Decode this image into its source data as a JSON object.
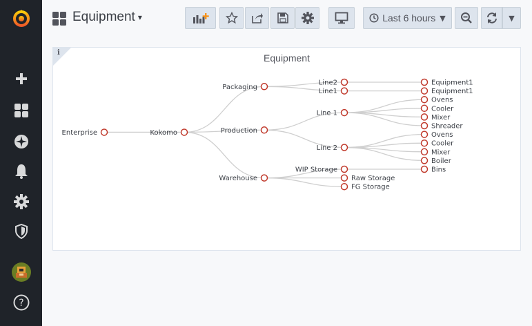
{
  "sidebar": {
    "items": [
      {
        "name": "grafana-logo-icon"
      },
      {
        "name": "plus-icon"
      },
      {
        "name": "dashboards-icon"
      },
      {
        "name": "explore-compass-icon"
      },
      {
        "name": "alerting-bell-icon"
      },
      {
        "name": "configuration-gear-icon"
      },
      {
        "name": "server-admin-shield-icon"
      },
      {
        "name": "user-avatar"
      },
      {
        "name": "help-icon"
      }
    ]
  },
  "header": {
    "title": "Equipment",
    "time_range": "Last 6 hours"
  },
  "colors": {
    "sidebar_bg": "#1f2329",
    "node_stroke": "#c0392b",
    "link_stroke": "#cfcfcf",
    "accent_orange": "#f7941d"
  },
  "panel": {
    "title": "Equipment",
    "info_glyph": "i"
  },
  "tree": {
    "name": "Enterprise",
    "children": [
      {
        "name": "Kokomo",
        "children": [
          {
            "name": "Packaging",
            "children": [
              {
                "name": "Line2",
                "children": [
                  {
                    "name": "Equipment1"
                  }
                ]
              },
              {
                "name": "Line1",
                "children": [
                  {
                    "name": "Equipment1"
                  }
                ]
              }
            ]
          },
          {
            "name": "Production",
            "children": [
              {
                "name": "Line 1",
                "children": [
                  {
                    "name": "Ovens"
                  },
                  {
                    "name": "Cooler"
                  },
                  {
                    "name": "Mixer"
                  },
                  {
                    "name": "Shreader"
                  }
                ]
              },
              {
                "name": "Line 2",
                "children": [
                  {
                    "name": "Ovens"
                  },
                  {
                    "name": "Cooler"
                  },
                  {
                    "name": "Mixer"
                  },
                  {
                    "name": "Boiler"
                  }
                ]
              }
            ]
          },
          {
            "name": "Warehouse",
            "children": [
              {
                "name": "WIP Storage",
                "children": [
                  {
                    "name": "Bins"
                  }
                ]
              },
              {
                "name": "Raw Storage"
              },
              {
                "name": "FG Storage"
              }
            ]
          }
        ]
      }
    ]
  }
}
